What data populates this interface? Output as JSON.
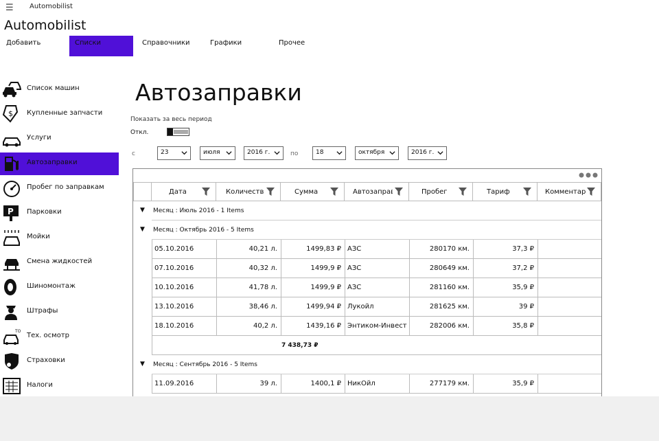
{
  "app": {
    "window_title": "Automobilist",
    "title": "Automobilist",
    "menu_icon": "hamburger-icon"
  },
  "menu": [
    {
      "label": "Добавить",
      "active": false
    },
    {
      "label": "Списки",
      "active": true
    },
    {
      "label": "Справочники",
      "active": false
    },
    {
      "label": "Графики",
      "active": false
    },
    {
      "label": "Прочее",
      "active": false
    }
  ],
  "colors": {
    "accent": "#5010d8",
    "footer": "#f0f0f0"
  },
  "nav": [
    {
      "label": "Список машин",
      "icon": "cars-icon",
      "active": false
    },
    {
      "label": "Купленные запчасти",
      "icon": "parts-tag-icon",
      "active": false
    },
    {
      "label": "Услуги",
      "icon": "service-car-icon",
      "active": false
    },
    {
      "label": "Автозаправки",
      "icon": "fuel-pump-icon",
      "active": true
    },
    {
      "label": "Пробег по заправкам",
      "icon": "speedometer-icon",
      "active": false
    },
    {
      "label": "Парковки",
      "icon": "parking-icon",
      "active": false
    },
    {
      "label": "Мойки",
      "icon": "car-wash-icon",
      "active": false
    },
    {
      "label": "Смена жидкостей",
      "icon": "car-lift-icon",
      "active": false
    },
    {
      "label": "Шиномонтаж",
      "icon": "tire-icon",
      "active": false
    },
    {
      "label": "Штрафы",
      "icon": "police-officer-icon",
      "active": false
    },
    {
      "label": "Тех. осмотр",
      "icon": "inspection-icon",
      "active": false
    },
    {
      "label": "Страховки",
      "icon": "insurance-icon",
      "active": false
    },
    {
      "label": "Налоги",
      "icon": "tax-calculator-icon",
      "active": false
    }
  ],
  "page": {
    "title": "Автозаправки",
    "period_label": "Показать за весь период",
    "toggle_label": "Откл.",
    "toggle_on": false,
    "from_label": "с",
    "to_label": "по",
    "from_day": "23",
    "from_month": "июля",
    "from_year": "2016 г.",
    "to_day": "18",
    "to_month": "октября",
    "to_year": "2016 г."
  },
  "grid": {
    "columns": [
      "Дата",
      "Количество",
      "Сумма",
      "Автозаправка",
      "Пробег",
      "Тариф",
      "Комментарий"
    ],
    "groups": [
      {
        "title": "Месяц : Июль 2016 - 1 Items",
        "rows": [],
        "total": ""
      },
      {
        "title": "Месяц : Октябрь 2016 - 5 Items",
        "rows": [
          [
            "05.10.2016",
            "40,21 л.",
            "1499,83 ₽",
            "АЗС",
            "280170 км.",
            "37,3 ₽",
            ""
          ],
          [
            "07.10.2016",
            "40,32 л.",
            "1499,9 ₽",
            "АЗС",
            "280649 км.",
            "37,2 ₽",
            ""
          ],
          [
            "10.10.2016",
            "41,78 л.",
            "1499,9 ₽",
            "АЗС",
            "281160 км.",
            "35,9 ₽",
            ""
          ],
          [
            "13.10.2016",
            "38,46 л.",
            "1499,94 ₽",
            "Лукойл",
            "281625 км.",
            "39 ₽",
            ""
          ],
          [
            "18.10.2016",
            "40,2 л.",
            "1439,16 ₽",
            "Энтиком-Инвест",
            "282006 км.",
            "35,8 ₽",
            ""
          ]
        ],
        "total": "7 438,73 ₽"
      },
      {
        "title": "Месяц : Сентябрь 2016 - 5 Items",
        "rows": [
          [
            "11.09.2016",
            "39 л.",
            "1400,1 ₽",
            "НикОйл",
            "277179 км.",
            "35,9 ₽",
            ""
          ]
        ],
        "total": ""
      }
    ]
  }
}
